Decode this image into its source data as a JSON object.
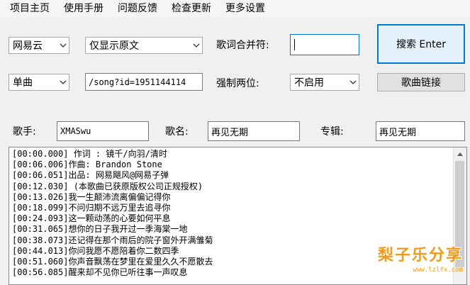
{
  "menu": [
    "项目主页",
    "使用手册",
    "问题反馈",
    "检查更新",
    "更多设置"
  ],
  "source_select": "网易云",
  "display_select": "仅显示原文",
  "merge_label": "歌词合并符:",
  "merge_value": "",
  "search_button": "搜索 Enter",
  "type_select": "单曲",
  "url_value": "/song?id=1951144114",
  "force_label": "强制两位:",
  "force_select": "不启用",
  "song_link_button": "歌曲链接",
  "singer_label": "歌手:",
  "singer_value": "XMASwu",
  "name_label": "歌名:",
  "name_value": "再见无期",
  "album_label": "专辑:",
  "album_value": "再见无期",
  "lyrics": [
    "[00:00.000] 作词 : 镜千/向羽/清时",
    "[00:06.006]作曲:  Brandon Stone",
    "[00:06.051]出品: 网易飓风@网易子弹",
    "[00:12.030] (本歌曲已获原版权公司正规授权)",
    "[00:13.026]我一生颠沛流离偏偏记得你",
    "[00:18.099]不问归期不远万里去追寻你",
    "[00:24.093]这一颗动荡的心要如何平息",
    "[00:31.065]想你的日子我开过一季海棠一地",
    "[00:38.073]还记得在那个雨后的院子窗外开满雏菊",
    "[00:44.013]你问我愿不愿陪着你二数四季",
    "[00:51.060]你声音飘荡在梦里在爱里久久不愿散去",
    "[00:56.085]醒来却不见你已听往事一声叹息"
  ],
  "watermark": {
    "title": "梨子乐分享",
    "url": "www.lzlfx.com"
  },
  "colors": {
    "accent": "#0078d7",
    "watermark": "#f09a1a"
  }
}
